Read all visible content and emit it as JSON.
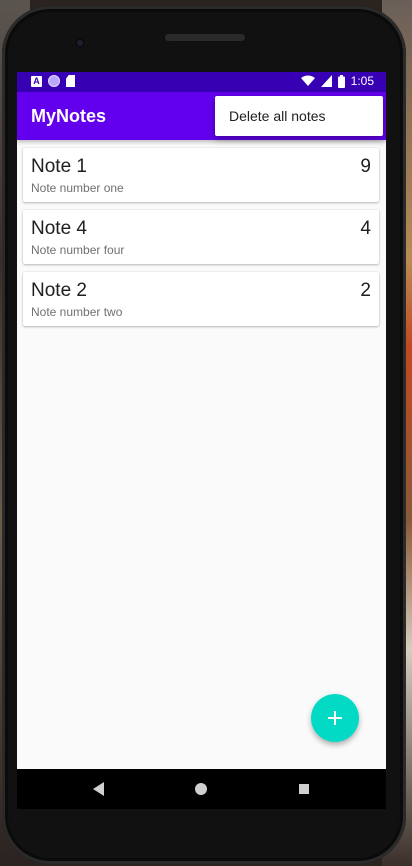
{
  "status_bar": {
    "time": "1:05",
    "icons": [
      "notification-a-icon",
      "circle-notification-icon",
      "sd-card-icon",
      "wifi-icon",
      "signal-icon",
      "battery-icon"
    ]
  },
  "app_bar": {
    "title": "MyNotes"
  },
  "overflow_menu": {
    "items": [
      {
        "label": "Delete all notes"
      }
    ]
  },
  "notes": [
    {
      "title": "Note 1",
      "description": "Note number one",
      "priority": "9"
    },
    {
      "title": "Note 4",
      "description": "Note number four",
      "priority": "4"
    },
    {
      "title": "Note 2",
      "description": "Note number two",
      "priority": "2"
    }
  ],
  "fab": {
    "icon": "plus-icon"
  },
  "navigation": {
    "icons": [
      "back-icon",
      "home-icon",
      "recents-icon"
    ]
  },
  "colors": {
    "primary": "#6200ee",
    "primary_dark": "#3700b3",
    "accent": "#03dac5",
    "background": "#fafafa"
  }
}
